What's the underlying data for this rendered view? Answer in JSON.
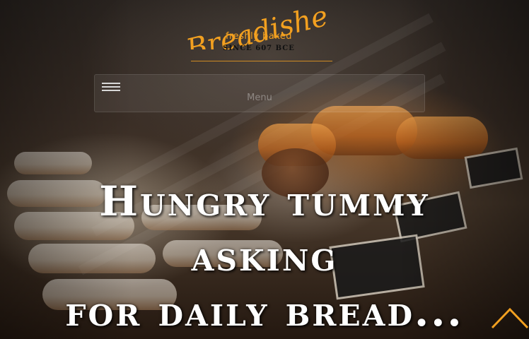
{
  "logo": {
    "wordmark": "Breadishe",
    "tagline": "freshly baked",
    "since": "SINCE 607 BCE"
  },
  "nav": {
    "menu_label": "Menu",
    "toggle_icon": "hamburger-icon"
  },
  "hero": {
    "headline_lines": [
      "Hungry tummy",
      "asking",
      "for daily bread..."
    ]
  },
  "scroll_top": {
    "icon": "chevron-up-icon"
  },
  "colors": {
    "brand_orange": "#f2a020",
    "headline": "#ffffff"
  }
}
